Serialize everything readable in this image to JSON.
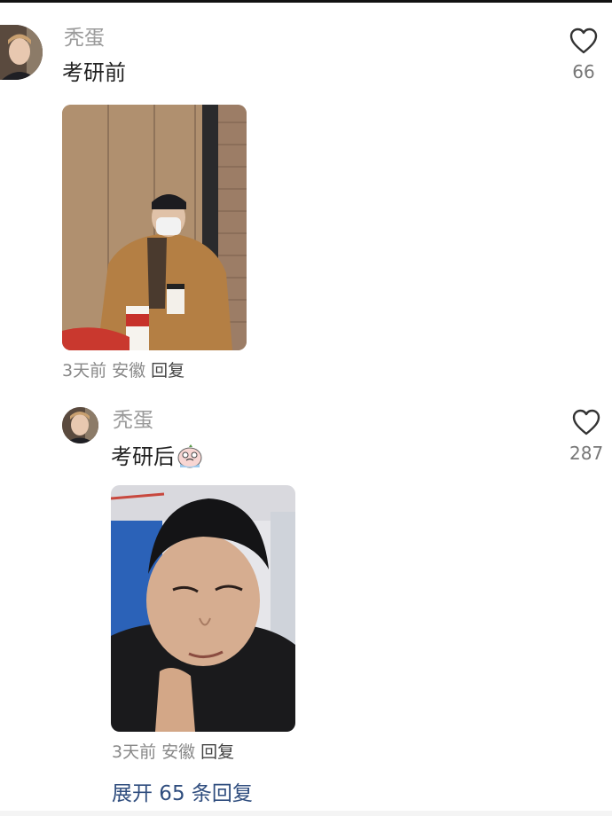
{
  "comment": {
    "username": "秃蛋",
    "text": "考研前",
    "likes": "66",
    "time": "3天前",
    "location": "安徽",
    "reply_label": "回复"
  },
  "reply": {
    "username": "秃蛋",
    "text": "考研后",
    "emoji_icon": "crying-emoji-icon",
    "likes": "287",
    "time": "3天前",
    "location": "安徽",
    "reply_label": "回复"
  },
  "expand_label": "展开 65 条回复",
  "colors": {
    "username": "#9a9a9a",
    "text": "#222222",
    "meta": "#888888",
    "link": "#2f4d7e"
  }
}
